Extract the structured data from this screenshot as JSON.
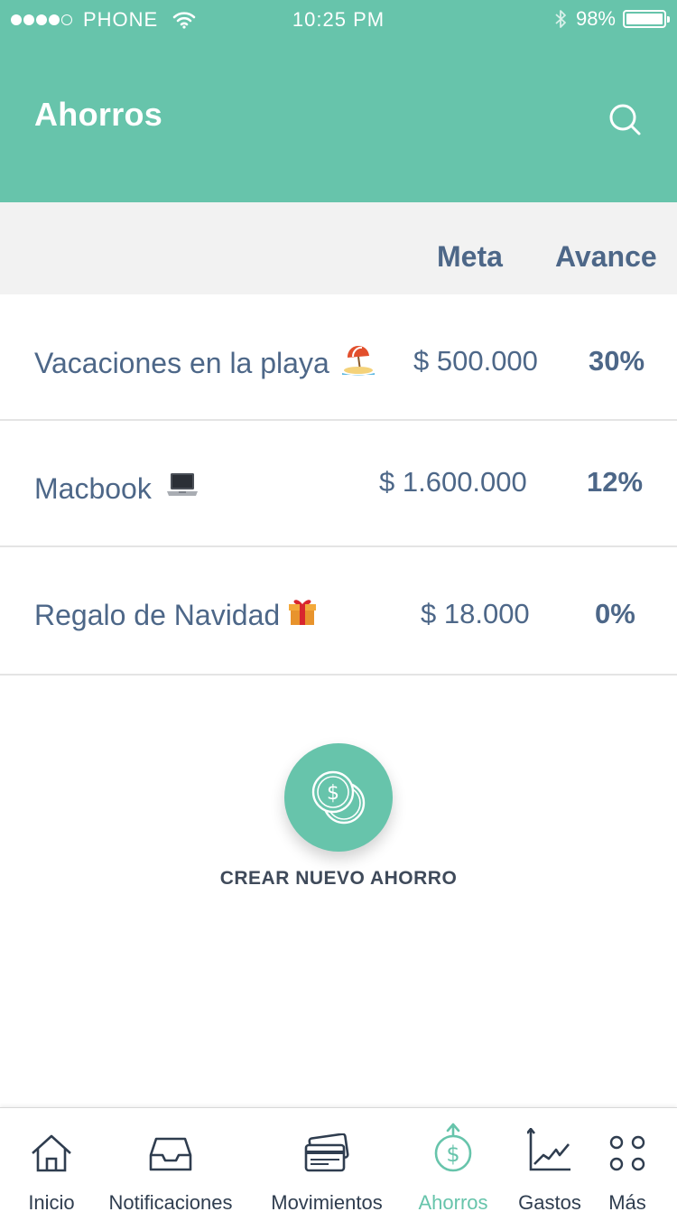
{
  "status_bar": {
    "carrier": "PHONE",
    "time": "10:25 PM",
    "battery": "98%",
    "battery_level": 0.98,
    "signal_bars_filled": 4,
    "signal_bars_total": 5
  },
  "header": {
    "title": "Ahorros",
    "search_icon": "search-icon"
  },
  "columns": {
    "meta": "Meta",
    "avance": "Avance"
  },
  "savings": [
    {
      "name": "Vacaciones en la playa",
      "emoji": "🏖",
      "goal": "$ 500.000",
      "progress": "30%"
    },
    {
      "name": "Macbook",
      "emoji": "💻",
      "goal": "$ 1.600.000",
      "progress": "12%"
    },
    {
      "name": "Regalo de Navidad",
      "emoji": "🎁",
      "goal": "$ 18.000",
      "progress": "0%"
    }
  ],
  "create": {
    "icon": "coins-icon",
    "label": "CREAR NUEVO AHORRO"
  },
  "tabs": [
    {
      "label": "Inicio",
      "icon": "home-icon"
    },
    {
      "label": "Notificaciones",
      "icon": "inbox-icon"
    },
    {
      "label": "Movimientos",
      "icon": "cards-icon"
    },
    {
      "label": "Ahorros",
      "icon": "savings-icon"
    },
    {
      "label": "Gastos",
      "icon": "chart-icon"
    },
    {
      "label": "Más",
      "icon": "more-icon"
    }
  ],
  "colors": {
    "accent": "#67c4ab",
    "text": "#4d6788",
    "header_band": "#f2f2f2"
  }
}
